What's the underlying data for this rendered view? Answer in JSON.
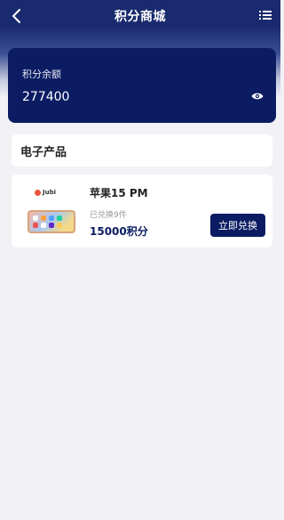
{
  "header": {
    "title": "积分商城",
    "back_icon": "back-arrow-icon",
    "menu_icon": "list-menu-icon"
  },
  "balance": {
    "label": "积分余额",
    "value": "277400",
    "visibility_icon": "eye-icon"
  },
  "section": {
    "title": "电子产品"
  },
  "products": [
    {
      "name": "苹果15 PM",
      "redeemed": "已兑换9件",
      "price": "15000积分",
      "button_label": "立即兑换",
      "thumb_brand": "Jubi"
    }
  ],
  "colors": {
    "primary": "#0b1c63",
    "header": "#1a2a6e",
    "background": "#f2f2f6"
  }
}
